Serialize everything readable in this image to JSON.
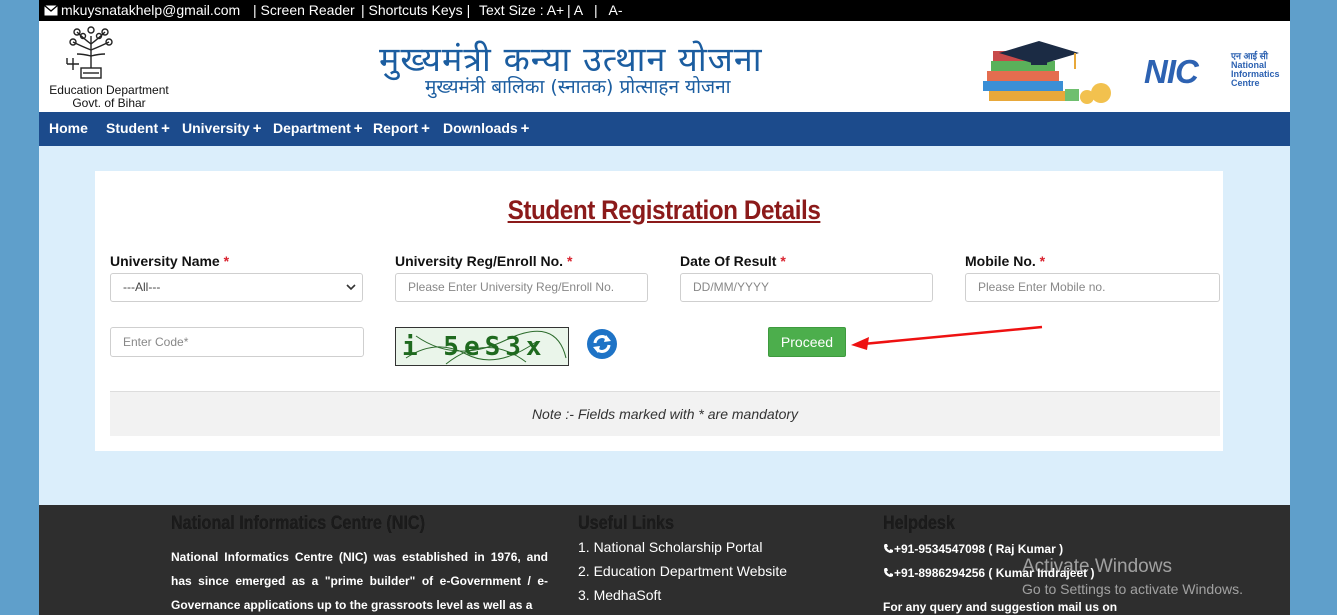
{
  "topbar": {
    "email": "mkuysnatakhelp@gmail.com",
    "screen_reader": "| Screen Reader",
    "shortcuts": "| Shortcuts Keys |",
    "text_size": "Text Size : A+",
    "a_normal": "| A",
    "a_minus": "|   A-"
  },
  "header": {
    "dept_line1": "Education Department",
    "dept_line2": "Govt. of Bihar",
    "title_hindi": "मुख्यमंत्री कन्या उत्थान योजना",
    "subtitle_hindi": "मुख्यमंत्री बालिका (स्नातक) प्रोत्साहन योजना",
    "nic_label": "NIC",
    "nic_hindi": "एन आई सी",
    "nic_line1": "National",
    "nic_line2": "Informatics",
    "nic_line3": "Centre"
  },
  "nav": {
    "home": "Home",
    "student": "Student",
    "university": "University",
    "department": "Department",
    "report": "Report",
    "downloads": "Downloads",
    "plus": "+"
  },
  "form": {
    "title": "Student Registration Details",
    "university_name_label": "University Name",
    "reg_label": "University Reg/Enroll No.",
    "date_label": "Date Of Result",
    "mobile_label": "Mobile No.",
    "required_mark": "*",
    "university_selected": "---All---",
    "reg_placeholder": "Please Enter University Reg/Enroll No.",
    "date_placeholder": "DD/MM/YYYY",
    "mobile_placeholder": "Please Enter Mobile no.",
    "code_placeholder": "Enter Code*",
    "captcha_text": "i 5eS3x",
    "proceed_label": "Proceed",
    "note": "Note :- Fields marked with * are mandatory"
  },
  "footer": {
    "nic_title": "National Informatics Centre (NIC)",
    "nic_para": "National Informatics Centre (NIC) was established in 1976, and has since emerged as a \"prime builder\" of e-Government / e-Governance applications up to the grassroots level as well as a",
    "links_title": "Useful Links",
    "links": [
      "1. National Scholarship Portal",
      "2. Education Department Website",
      "3. MedhaSoft"
    ],
    "help_title": "Helpdesk",
    "phone1": "+91-9534547098 ( Raj Kumar )",
    "phone2": "+91-8986294256 ( Kumar Indrajeet )",
    "query": "For any query and suggestion mail us on"
  },
  "watermark": {
    "line1": "Activate Windows",
    "line2": "Go to Settings to activate Windows."
  },
  "colors": {
    "nav_bg": "#1c4b8c",
    "title": "#8b1a1a",
    "proceed": "#4cae4c",
    "page_bg": "#dbeefb"
  }
}
